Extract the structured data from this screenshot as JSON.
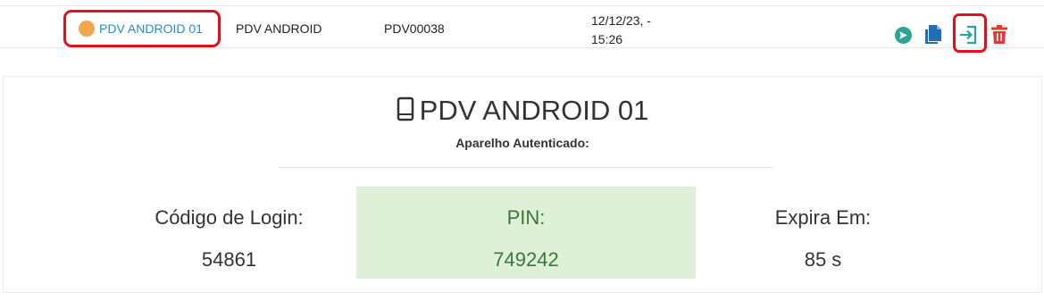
{
  "row": {
    "device_name": "PDV ANDROID 01",
    "device_type": "PDV ANDROID",
    "device_code": "PDV00038",
    "date_line1": "12/12/23, -",
    "date_line2": "15:26",
    "status_color": "#f0a84a",
    "actions": [
      {
        "icon": "send-icon",
        "color": "#2aa594"
      },
      {
        "icon": "copy-icon",
        "color": "#1e6fb3"
      },
      {
        "icon": "login-icon",
        "color": "#26a69a"
      },
      {
        "icon": "trash-icon",
        "color": "#e53935"
      }
    ]
  },
  "panel": {
    "title": "PDV ANDROID 01",
    "title_icon": "tablet-icon",
    "subtitle": "Aparelho Autenticado:",
    "login_code_label": "Código de Login:",
    "login_code_value": "54861",
    "pin_label": "PIN:",
    "pin_value": "749242",
    "expires_label": "Expira Em:",
    "expires_value": "85 s",
    "pin_bg_color": "#dff0d8",
    "pin_text_color": "#3c763d"
  }
}
